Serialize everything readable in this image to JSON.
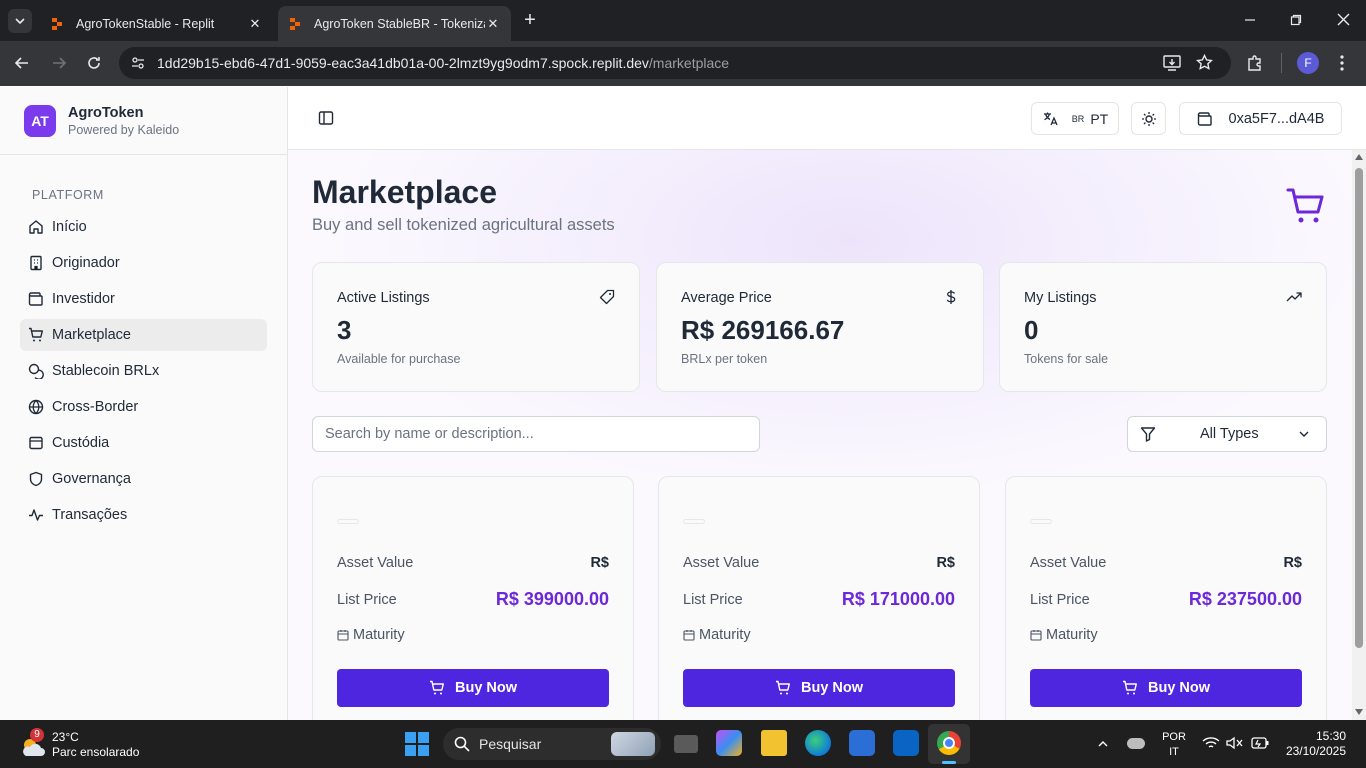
{
  "browser": {
    "tabs": [
      {
        "title": "AgroTokenStable - Replit",
        "active": false
      },
      {
        "title": "AgroToken StableBR - Tokeniza",
        "active": true
      }
    ],
    "url_host": "1dd29b15-ebd6-47d1-9059-eac3a41db01a-00-2lmzt9yg9odm7.spock.replit.dev",
    "url_path": "/marketplace",
    "profile_initial": "F"
  },
  "sidebar": {
    "logo": "AT",
    "brand_name": "AgroToken",
    "brand_sub": "Powered by Kaleido",
    "section": "PLATFORM",
    "items": [
      {
        "label": "Início",
        "icon": "home-icon"
      },
      {
        "label": "Originador",
        "icon": "building-icon"
      },
      {
        "label": "Investidor",
        "icon": "wallet-icon"
      },
      {
        "label": "Marketplace",
        "icon": "cart-icon",
        "active": true
      },
      {
        "label": "Stablecoin BRLx",
        "icon": "coins-icon"
      },
      {
        "label": "Cross-Border",
        "icon": "globe-icon"
      },
      {
        "label": "Custódia",
        "icon": "lock-icon"
      },
      {
        "label": "Governança",
        "icon": "shield-icon"
      },
      {
        "label": "Transações",
        "icon": "activity-icon"
      }
    ]
  },
  "header": {
    "lang_flag": "BR",
    "lang_code": "PT",
    "wallet": "0xa5F7...dA4B"
  },
  "page": {
    "title": "Marketplace",
    "subtitle": "Buy and sell tokenized agricultural assets"
  },
  "stats": [
    {
      "label": "Active Listings",
      "value": "3",
      "desc": "Available for purchase",
      "icon": "tag-icon"
    },
    {
      "label": "Average Price",
      "value": "R$ 269166.67",
      "desc": "BRLx per token",
      "icon": "dollar-icon"
    },
    {
      "label": "My Listings",
      "value": "0",
      "desc": "Tokens for sale",
      "icon": "trending-up-icon"
    }
  ],
  "search": {
    "placeholder": "Search by name or description..."
  },
  "filter": {
    "value": "All Types"
  },
  "listings": [
    {
      "asset_value_label": "Asset Value",
      "asset_value": "R$",
      "list_price_label": "List Price",
      "list_price": "R$ 399000.00",
      "maturity_label": "Maturity",
      "buy_label": "Buy Now"
    },
    {
      "asset_value_label": "Asset Value",
      "asset_value": "R$",
      "list_price_label": "List Price",
      "list_price": "R$ 171000.00",
      "maturity_label": "Maturity",
      "buy_label": "Buy Now"
    },
    {
      "asset_value_label": "Asset Value",
      "asset_value": "R$",
      "list_price_label": "List Price",
      "list_price": "R$ 237500.00",
      "maturity_label": "Maturity",
      "buy_label": "Buy Now"
    }
  ],
  "taskbar": {
    "weather_badge": "9",
    "temp": "23°C",
    "weather_desc": "Parc ensolarado",
    "search_label": "Pesquisar",
    "lang_line1": "POR",
    "lang_line2": "IT",
    "time": "15:30",
    "date": "23/10/2025"
  },
  "colors": {
    "accent": "#4f26e0",
    "price": "#6d28d9",
    "logo": "#7c3aed"
  }
}
